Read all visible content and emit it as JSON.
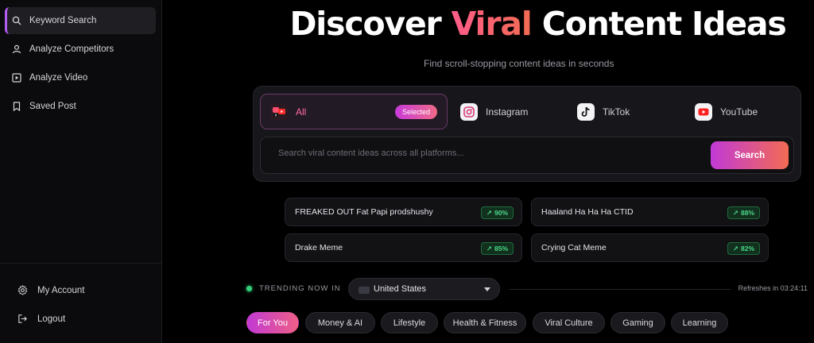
{
  "sidebar": {
    "nav": [
      {
        "label": "Keyword Search",
        "icon": "search-icon"
      },
      {
        "label": "Analyze Competitors",
        "icon": "user-icon"
      },
      {
        "label": "Analyze Video",
        "icon": "play-square-icon"
      },
      {
        "label": "Saved Post",
        "icon": "bookmark-icon"
      }
    ],
    "account": [
      {
        "label": "My Account",
        "icon": "gear-icon"
      },
      {
        "label": "Logout",
        "icon": "logout-icon"
      }
    ]
  },
  "hero": {
    "title_pre": "Discover ",
    "title_accent": "Viral",
    "title_post": " Content Ideas",
    "subtitle": "Find scroll-stopping content ideas in seconds"
  },
  "platforms": {
    "tabs": [
      {
        "label": "All",
        "badge": "Selected",
        "icon": "all-platforms-icon"
      },
      {
        "label": "Instagram",
        "icon": "instagram-icon"
      },
      {
        "label": "TikTok",
        "icon": "tiktok-icon"
      },
      {
        "label": "YouTube",
        "icon": "youtube-icon"
      }
    ]
  },
  "search": {
    "placeholder": "Search viral content ideas across all platforms...",
    "button": "Search"
  },
  "suggestions": [
    {
      "text": "FREAKED OUT Fat Papi prodshushy",
      "score": "90%"
    },
    {
      "text": "Haaland Ha Ha Ha CTID",
      "score": "88%"
    },
    {
      "text": "Drake Meme",
      "score": "85%"
    },
    {
      "text": "Crying Cat Meme",
      "score": "82%"
    }
  ],
  "trending": {
    "label": "TRENDING NOW IN",
    "country": "United States",
    "refresh": "Refreshes in 03:24:11"
  },
  "categories": [
    "For You",
    "Money & AI",
    "Lifestyle",
    "Health & Fitness",
    "Viral Culture",
    "Gaming",
    "Learning"
  ],
  "colors": {
    "accent_pink": "#ff5c8a",
    "accent_purple": "#c13ad6",
    "accent_orange": "#f36b52",
    "score_green": "#4cd98a",
    "live_green": "#36d27a"
  }
}
